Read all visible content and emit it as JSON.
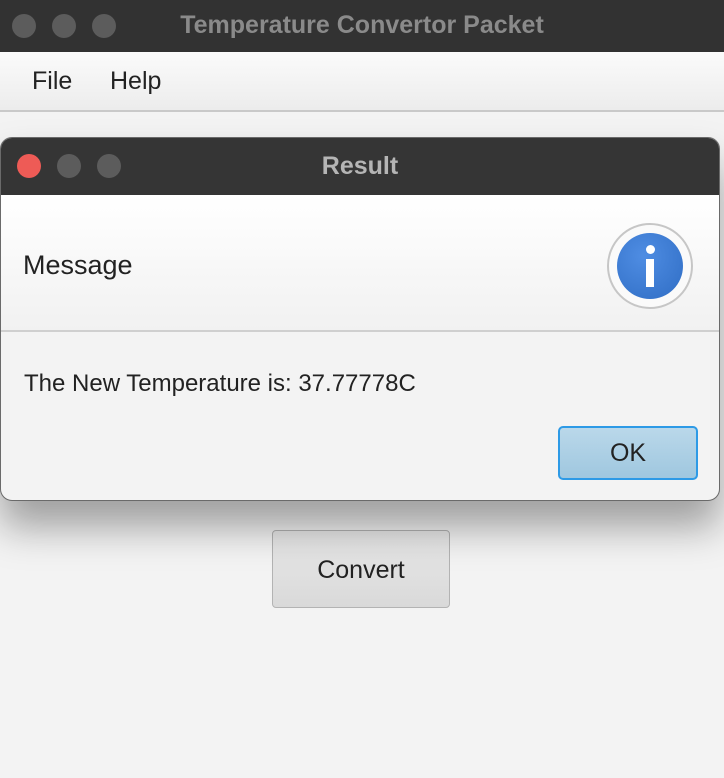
{
  "main_window": {
    "title": "Temperature Convertor Packet",
    "menu": {
      "items": [
        {
          "label": "File"
        },
        {
          "label": "Help"
        }
      ]
    },
    "convert_label": "Convert"
  },
  "dialog": {
    "title": "Result",
    "header_text": "Message",
    "icon": "info-icon",
    "content_text": "The New Temperature is: 37.77778C",
    "ok_label": "OK"
  },
  "colors": {
    "titlebar": "#323232",
    "close_button": "#ee5b56",
    "ok_border": "#2d9ae6",
    "info_blue": "#3a78d2"
  }
}
